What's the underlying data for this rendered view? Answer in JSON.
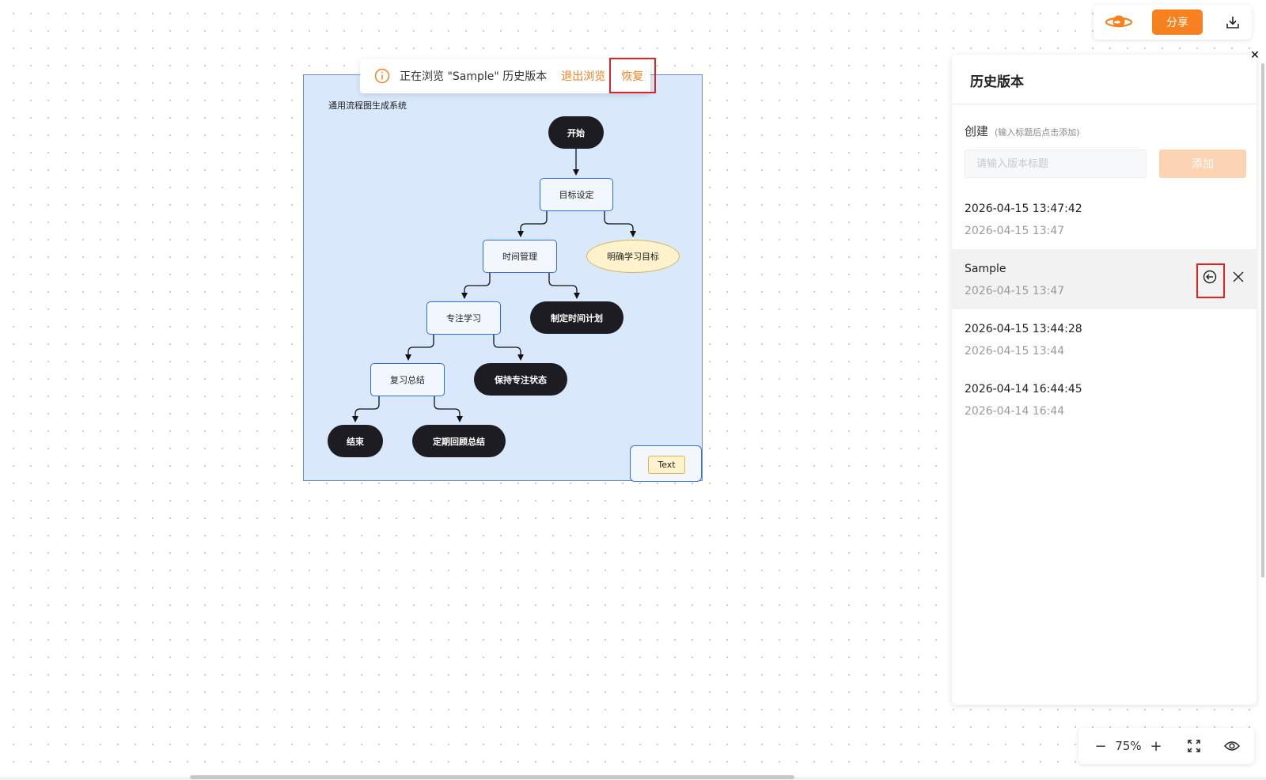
{
  "toolbar": {
    "logo_icon": "planet-logo-icon",
    "share_label": "分享",
    "download_icon": "download-icon",
    "accent_color": "#f7811f"
  },
  "banner": {
    "info_icon": "info-icon",
    "message": "正在浏览 \"Sample\" 历史版本",
    "exit_label": "退出浏览",
    "restore_label": "恢复"
  },
  "diagram": {
    "title": "通用流程图生成系统",
    "nodes": {
      "start": "开始",
      "goal_setting": "目标设定",
      "clear_goal": "明确学习目标",
      "time_mgmt": "时间管理",
      "make_plan": "制定时间计划",
      "focus_study": "专注学习",
      "keep_focus": "保持专注状态",
      "review": "复习总结",
      "end": "结束",
      "regular_review": "定期回顾总结"
    },
    "text_chip": "Text"
  },
  "history_panel": {
    "title": "历史版本",
    "create_label": "创建",
    "create_hint": "(输入标题后点击添加)",
    "input_placeholder": "请输入版本标题",
    "add_label": "添加",
    "versions": [
      {
        "name": "2026-04-15 13:47:42",
        "time": "2026-04-15 13:47"
      },
      {
        "name": "Sample",
        "time": "2026-04-15 13:47"
      },
      {
        "name": "2026-04-15 13:44:28",
        "time": "2026-04-15 13:44"
      },
      {
        "name": "2026-04-14 16:44:45",
        "time": "2026-04-14 16:44"
      }
    ],
    "close_icon": "close-icon"
  },
  "zoom": {
    "value": "75%",
    "minus_icon": "zoom-out-icon",
    "plus_icon": "zoom-in-icon",
    "fit_icon": "fullscreen-icon",
    "preview_icon": "eye-icon"
  }
}
